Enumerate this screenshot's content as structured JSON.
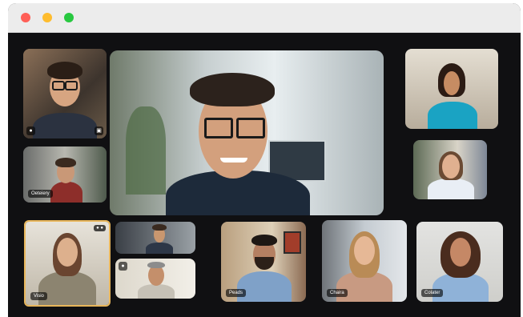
{
  "window": {
    "controls": [
      "close",
      "minimize",
      "maximize"
    ]
  },
  "participants": {
    "tile_1": {
      "label": "Oeteiery"
    },
    "tile_2": {
      "label": "Visio"
    },
    "tile_3": {
      "label": "Peads"
    },
    "tile_4": {
      "label": "Chaira"
    },
    "tile_5": {
      "label": "Colater"
    }
  },
  "colors": {
    "active_speaker_border": "#e8b65b",
    "window_bg": "#0f0f10",
    "titlebar": "#ececec"
  }
}
